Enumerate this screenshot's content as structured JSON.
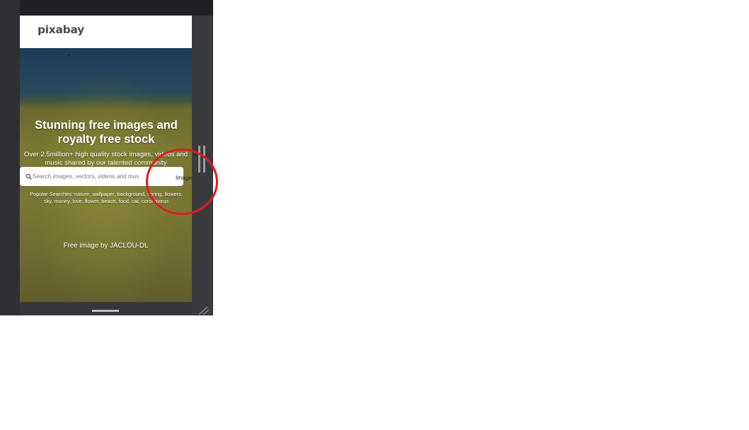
{
  "app": {
    "logo_text": "pixabay"
  },
  "hero": {
    "title_line1": "Stunning free images and",
    "title_line2": "royalty free stock",
    "subtitle_line1": "Over 2.5million+ high quality stock images, videos and",
    "subtitle_line2": "music shared by our talented community",
    "credit": "Free image by JACLOU-DL"
  },
  "search": {
    "placeholder": "Search images, vectors, videos and music",
    "value": "",
    "type_selected": "Images"
  },
  "popular": {
    "line1": "Popular Searches: nature, wallpaper, background, spring, flowers,",
    "line2": "sky, money, love, flower, beach, food, cat, coronavirus"
  },
  "colors": {
    "frame": "#2f3034",
    "annotation": "#e11b22",
    "search_bg": "#ffffff"
  },
  "icons": {
    "search": "search-icon",
    "drag": "drag-handle-icon",
    "resize": "resize-corner-icon"
  }
}
